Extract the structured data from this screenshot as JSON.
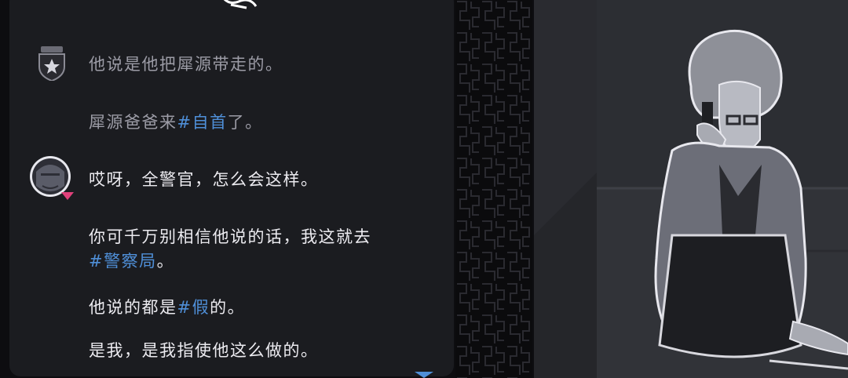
{
  "dialog": {
    "messages": [
      {
        "speaker_icon": "police-badge-icon",
        "dim": true,
        "segments": [
          {
            "text": "他说是他把犀源带走的。"
          }
        ]
      },
      {
        "speaker_icon": "",
        "dim": true,
        "segments": [
          {
            "text": "犀源爸爸来"
          },
          {
            "text": "#自首",
            "keyword": true
          },
          {
            "text": "了。"
          }
        ]
      },
      {
        "speaker_icon": "old-woman-avatar-icon",
        "dim": false,
        "segments": [
          {
            "text": "哎呀，全警官，怎么会这样。"
          }
        ]
      },
      {
        "speaker_icon": "",
        "dim": false,
        "segments": [
          {
            "text": "你可千万别相信他说的话，我这就去"
          }
        ]
      },
      {
        "speaker_icon": "",
        "dim": false,
        "segments": [
          {
            "text": "#警察局",
            "keyword": true
          },
          {
            "text": "。"
          }
        ]
      },
      {
        "speaker_icon": "",
        "dim": false,
        "segments": [
          {
            "text": "他说的都是"
          },
          {
            "text": "#假",
            "keyword": true
          },
          {
            "text": "的。"
          }
        ]
      },
      {
        "speaker_icon": "",
        "dim": false,
        "segments": [
          {
            "text": "是我，是我指使他这么做的。"
          }
        ]
      }
    ],
    "scroll_indicator_icon": "down-arrow-icon"
  },
  "scene": {
    "illustration_icon": "elderly-woman-on-phone-pixel-art"
  },
  "colors": {
    "panel": "#1b1c20",
    "text": "#ecebf0",
    "dim_text": "#9c9ca6",
    "keyword": "#4f8fd8",
    "accent_pink": "#e0407a",
    "scroll_arrow": "#4f8fd8"
  }
}
